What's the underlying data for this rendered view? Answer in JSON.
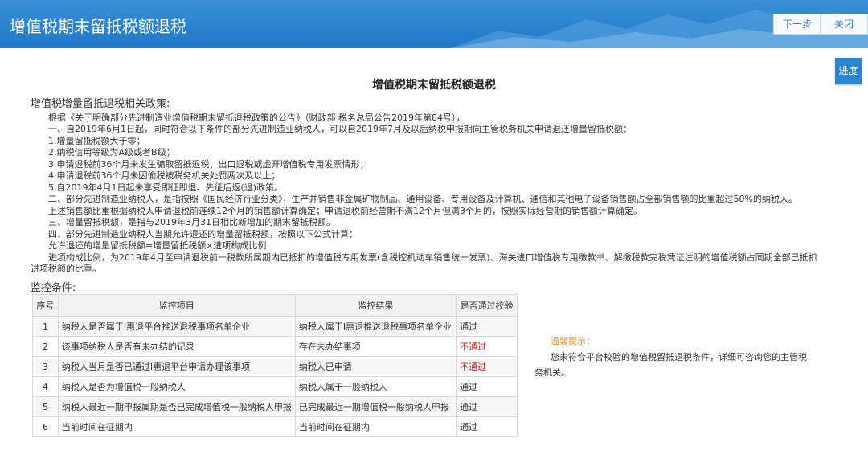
{
  "header": {
    "title": "增值税期末留抵税额退税",
    "next_label": "下一步",
    "close_label": "关闭"
  },
  "side": {
    "progress_label": "进度"
  },
  "page_title": "增值税期末留抵税额退税",
  "policy": {
    "heading": "增值税增量留抵退税相关政策:",
    "lines": [
      "根据《关于明确部分先进制造业增值税期末留抵退税政策的公告》（财政部 税务总局公告2019年第84号），",
      "一、自2019年6月1日起，同时符合以下条件的部分先进制造业纳税人，可以自2019年7月及以后纳税申报期向主管税务机关申请退还增量留抵税额：",
      "1.增量留抵税额大于零；",
      "2.纳税信用等级为A级或者B级；",
      "3.申请退税前36个月未发生骗取留抵退税、出口退税或虚开增值税专用发票情形；",
      "4.申请退税前36个月未因偷税被税务机关处罚两次及以上；",
      "5.自2019年4月1日起未享受即征即退、先征后返(退)政策。",
      "二、部分先进制造业纳税人，是指按照《国民经济行业分类》，生产并销售非金属矿物制品、通用设备、专用设备及计算机、通信和其他电子设备销售额占全部销售额的比重超过50%的纳税人。",
      "上述销售额比重根据纳税人申请退税前连续12个月的销售额计算确定；申请退税前经营期不满12个月但满3个月的，按照实际经营期的销售额计算确定。",
      "三、增量留抵税额，是指与2019年3月31日相比新增加的期末留抵税额。",
      "四、部分先进制造业纳税人当期允许退还的增量留抵税额，按照以下公式计算：",
      "允许退还的增量留抵税额=增量留抵税额×进项构成比例"
    ],
    "last_line_a": "进项构成比例，为2019年4月至申请退税前一税款所属期内已抵扣的增值税专用发票(含税控机动车销售统一发票)、海关进口增值税专用缴款书、解缴税款完税凭证注明的增值税额占同期全部已抵扣",
    "last_line_b": "进项税额的比重。"
  },
  "monitor": {
    "label": "监控条件:",
    "columns": [
      "序号",
      "监控项目",
      "监控结果",
      "是否通过校验"
    ],
    "rows": [
      {
        "no": "1",
        "item": "纳税人是否属于I惠退平台推送退税事项名单企业",
        "result": "纳税人属于I惠退推送退税事项名单企业",
        "pass": "通过",
        "ok": true
      },
      {
        "no": "2",
        "item": "该事项纳税人是否有未办结的记录",
        "result": "存在未办结事项",
        "pass": "不通过",
        "ok": false
      },
      {
        "no": "3",
        "item": "纳税人当月是否已通过I惠退平台申请办理该事项",
        "result": "纳税人已申请",
        "pass": "不通过",
        "ok": false
      },
      {
        "no": "4",
        "item": "纳税人是否为增值税一般纳税人",
        "result": "纳税人属于一般纳税人",
        "pass": "通过",
        "ok": true
      },
      {
        "no": "5",
        "item": "纳税人最近一期申报属期是否已完成增值税一般纳税人申报",
        "result": "已完成最近一期增值税一般纳税人申报",
        "pass": "通过",
        "ok": true
      },
      {
        "no": "6",
        "item": "当前时间在征期内",
        "result": "当前时间在征期内",
        "pass": "通过",
        "ok": true
      }
    ]
  },
  "tip": {
    "title": "温馨提示：",
    "text": "您未符合平台校验的增值税留抵退税条件，详细可咨询您的主管税务机关。"
  },
  "colors": {
    "header_blue": "#1f78c8",
    "fail_red": "#e02020",
    "tip_orange": "#e89020"
  }
}
